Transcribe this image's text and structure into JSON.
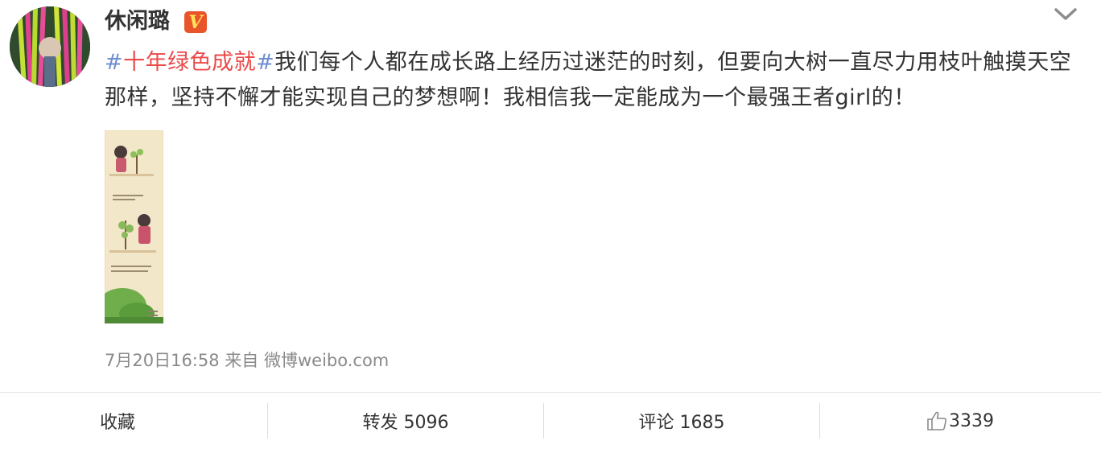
{
  "author": {
    "name": "休闲璐",
    "verified_badge": "V",
    "badge_color": "#e8552b"
  },
  "post": {
    "hashtag_open": "#",
    "topic": "十年绿色成就",
    "hashtag_close": "#",
    "body": "我们每个人都在成长路上经历过迷茫的时刻，但要向大树一直尽力用枝叶触摸天空那样，坚持不懈才能实现自己的梦想啊！我相信我一定能成为一个最强王者girl的！",
    "topic_color": "#eb4a4a",
    "hash_color": "#6f8fd0"
  },
  "meta": {
    "timestamp": "7月20日16:58",
    "from_label": "来自",
    "source": "微博weibo.com"
  },
  "actions": {
    "favorite": "收藏",
    "repost": "转发 5096",
    "comment": "评论 1685",
    "like_count": "3339"
  },
  "icons": {
    "menu": "chevron-down-icon",
    "like": "thumbs-up-icon"
  }
}
